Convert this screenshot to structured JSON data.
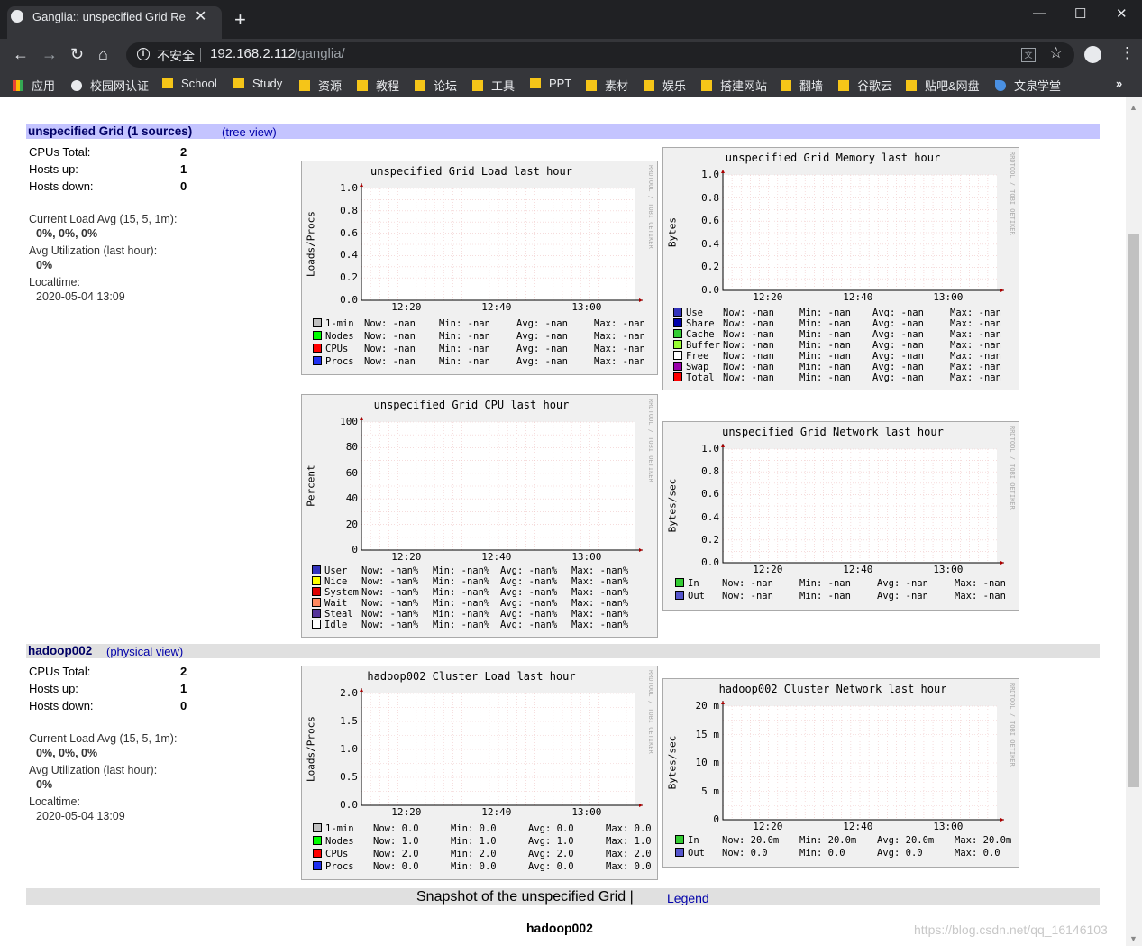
{
  "browser": {
    "tab_title": "Ganglia:: unspecified Grid Rep",
    "insecure_label": "不安全",
    "url_host": "192.168.2.112",
    "url_path": "/ganglia/",
    "bookmarks": [
      "应用",
      "校园网认证",
      "School",
      "Study",
      "资源",
      "教程",
      "论坛",
      "工具",
      "PPT",
      "素材",
      "娱乐",
      "搭建网站",
      "翻墙",
      "谷歌云",
      "贴吧&网盘",
      "文泉学堂"
    ]
  },
  "grid": {
    "title": "unspecified Grid (1 sources)",
    "tree_link": "(tree view)",
    "cpus_label": "CPUs Total:",
    "cpus_value": "2",
    "hosts_up_label": "Hosts up:",
    "hosts_up_value": "1",
    "hosts_down_label": "Hosts down:",
    "hosts_down_value": "0",
    "load_label": "Current Load Avg (15, 5, 1m):",
    "load_value": "0%, 0%, 0%",
    "util_label": "Avg Utilization (last hour):",
    "util_value": "0%",
    "localtime_label": "Localtime:",
    "localtime_value": "2020-05-04 13:09"
  },
  "cluster": {
    "title": "hadoop002",
    "physical_link": "(physical view)",
    "cpus_label": "CPUs Total:",
    "cpus_value": "2",
    "hosts_up_label": "Hosts up:",
    "hosts_up_value": "1",
    "hosts_down_label": "Hosts down:",
    "hosts_down_value": "0",
    "load_label": "Current Load Avg (15, 5, 1m):",
    "load_value": "0%, 0%, 0%",
    "util_label": "Avg Utilization (last hour):",
    "util_value": "0%",
    "localtime_label": "Localtime:",
    "localtime_value": "2020-05-04 13:09"
  },
  "rrdtool_credit": "RRDTOOL / TOBI OETIKER",
  "graphs": {
    "grid_load": {
      "title": "unspecified Grid Load last hour",
      "ylabel": "Loads/Procs",
      "yticks": [
        "1.0",
        "0.8",
        "0.6",
        "0.4",
        "0.2",
        "0.0"
      ],
      "xticks": [
        "12:20",
        "12:40",
        "13:00"
      ],
      "legend": [
        {
          "color": "#c0c0c0",
          "name": "1-min",
          "now": "-nan",
          "min": "-nan",
          "avg": "-nan",
          "max": "-nan"
        },
        {
          "color": "#00ff00",
          "name": "Nodes",
          "now": "-nan",
          "min": "-nan",
          "avg": "-nan",
          "max": "-nan"
        },
        {
          "color": "#ff0000",
          "name": "CPUs",
          "now": "-nan",
          "min": "-nan",
          "avg": "-nan",
          "max": "-nan"
        },
        {
          "color": "#2030f0",
          "name": "Procs",
          "now": "-nan",
          "min": "-nan",
          "avg": "-nan",
          "max": "-nan"
        }
      ]
    },
    "grid_memory": {
      "title": "unspecified Grid Memory last hour",
      "ylabel": "Bytes",
      "yticks": [
        "1.0",
        "0.8",
        "0.6",
        "0.4",
        "0.2",
        "0.0"
      ],
      "xticks": [
        "12:20",
        "12:40",
        "13:00"
      ],
      "legend": [
        {
          "color": "#3333bb",
          "name": "Use",
          "now": "-nan",
          "min": "-nan",
          "avg": "-nan",
          "max": "-nan"
        },
        {
          "color": "#0000aa",
          "name": "Share",
          "now": "-nan",
          "min": "-nan",
          "avg": "-nan",
          "max": "-nan"
        },
        {
          "color": "#33cc33",
          "name": "Cache",
          "now": "-nan",
          "min": "-nan",
          "avg": "-nan",
          "max": "-nan"
        },
        {
          "color": "#99ff33",
          "name": "Buffer",
          "now": "-nan",
          "min": "-nan",
          "avg": "-nan",
          "max": "-nan"
        },
        {
          "color": "#ffffff",
          "name": "Free",
          "now": "-nan",
          "min": "-nan",
          "avg": "-nan",
          "max": "-nan"
        },
        {
          "color": "#9900aa",
          "name": "Swap",
          "now": "-nan",
          "min": "-nan",
          "avg": "-nan",
          "max": "-nan"
        },
        {
          "color": "#ff0000",
          "name": "Total",
          "now": "-nan",
          "min": "-nan",
          "avg": "-nan",
          "max": "-nan"
        }
      ]
    },
    "grid_cpu": {
      "title": "unspecified Grid CPU last hour",
      "ylabel": "Percent",
      "yticks": [
        "100",
        "80",
        "60",
        "40",
        "20",
        "0"
      ],
      "xticks": [
        "12:20",
        "12:40",
        "13:00"
      ],
      "legend": [
        {
          "color": "#3333bb",
          "name": "User",
          "now": "-nan%",
          "min": "-nan%",
          "avg": "-nan%",
          "max": "-nan%"
        },
        {
          "color": "#ffff00",
          "name": "Nice",
          "now": "-nan%",
          "min": "-nan%",
          "avg": "-nan%",
          "max": "-nan%"
        },
        {
          "color": "#dd0000",
          "name": "System",
          "now": "-nan%",
          "min": "-nan%",
          "avg": "-nan%",
          "max": "-nan%"
        },
        {
          "color": "#ff8a60",
          "name": "Wait",
          "now": "-nan%",
          "min": "-nan%",
          "avg": "-nan%",
          "max": "-nan%"
        },
        {
          "color": "#553399",
          "name": "Steal",
          "now": "-nan%",
          "min": "-nan%",
          "avg": "-nan%",
          "max": "-nan%"
        },
        {
          "color": "#ffffff",
          "name": "Idle",
          "now": "-nan%",
          "min": "-nan%",
          "avg": "-nan%",
          "max": "-nan%"
        }
      ]
    },
    "grid_network": {
      "title": "unspecified Grid Network last hour",
      "ylabel": "Bytes/sec",
      "yticks": [
        "1.0",
        "0.8",
        "0.6",
        "0.4",
        "0.2",
        "0.0"
      ],
      "xticks": [
        "12:20",
        "12:40",
        "13:00"
      ],
      "legend": [
        {
          "color": "#33cc33",
          "name": "In",
          "now": "-nan",
          "min": "-nan",
          "avg": "-nan",
          "max": "-nan"
        },
        {
          "color": "#5555cc",
          "name": "Out",
          "now": "-nan",
          "min": "-nan",
          "avg": "-nan",
          "max": "-nan"
        }
      ]
    },
    "cluster_load": {
      "title": "hadoop002 Cluster Load last hour",
      "ylabel": "Loads/Procs",
      "yticks": [
        "2.0",
        "1.5",
        "1.0",
        "0.5",
        "0.0"
      ],
      "xticks": [
        "12:20",
        "12:40",
        "13:00"
      ],
      "legend": [
        {
          "color": "#c0c0c0",
          "name": "1-min",
          "now": "0.0",
          "min": "0.0",
          "avg": "0.0",
          "max": "0.0"
        },
        {
          "color": "#00ff00",
          "name": "Nodes",
          "now": "1.0",
          "min": "1.0",
          "avg": "1.0",
          "max": "1.0"
        },
        {
          "color": "#ff0000",
          "name": "CPUs",
          "now": "2.0",
          "min": "2.0",
          "avg": "2.0",
          "max": "2.0"
        },
        {
          "color": "#2030f0",
          "name": "Procs",
          "now": "0.0",
          "min": "0.0",
          "avg": "0.0",
          "max": "0.0"
        }
      ]
    },
    "cluster_network": {
      "title": "hadoop002 Cluster Network last hour",
      "ylabel": "Bytes/sec",
      "yticks": [
        "20 m",
        "15 m",
        "10 m",
        "5 m",
        "0"
      ],
      "xticks": [
        "12:20",
        "12:40",
        "13:00"
      ],
      "legend": [
        {
          "color": "#33cc33",
          "name": "In",
          "now": "20.0m",
          "min": "20.0m",
          "avg": "20.0m",
          "max": "20.0m"
        },
        {
          "color": "#5555cc",
          "name": "Out",
          "now": "0.0",
          "min": "0.0",
          "avg": "0.0",
          "max": "0.0"
        }
      ]
    }
  },
  "legend_labels": {
    "now": "Now:",
    "min": "Min:",
    "avg": "Avg:",
    "max": "Max:"
  },
  "footer": {
    "snapshot_text": "Snapshot of the unspecified Grid |",
    "legend_link": "Legend",
    "node_name": "hadoop002"
  },
  "watermark": "https://blog.csdn.net/qq_16146103"
}
